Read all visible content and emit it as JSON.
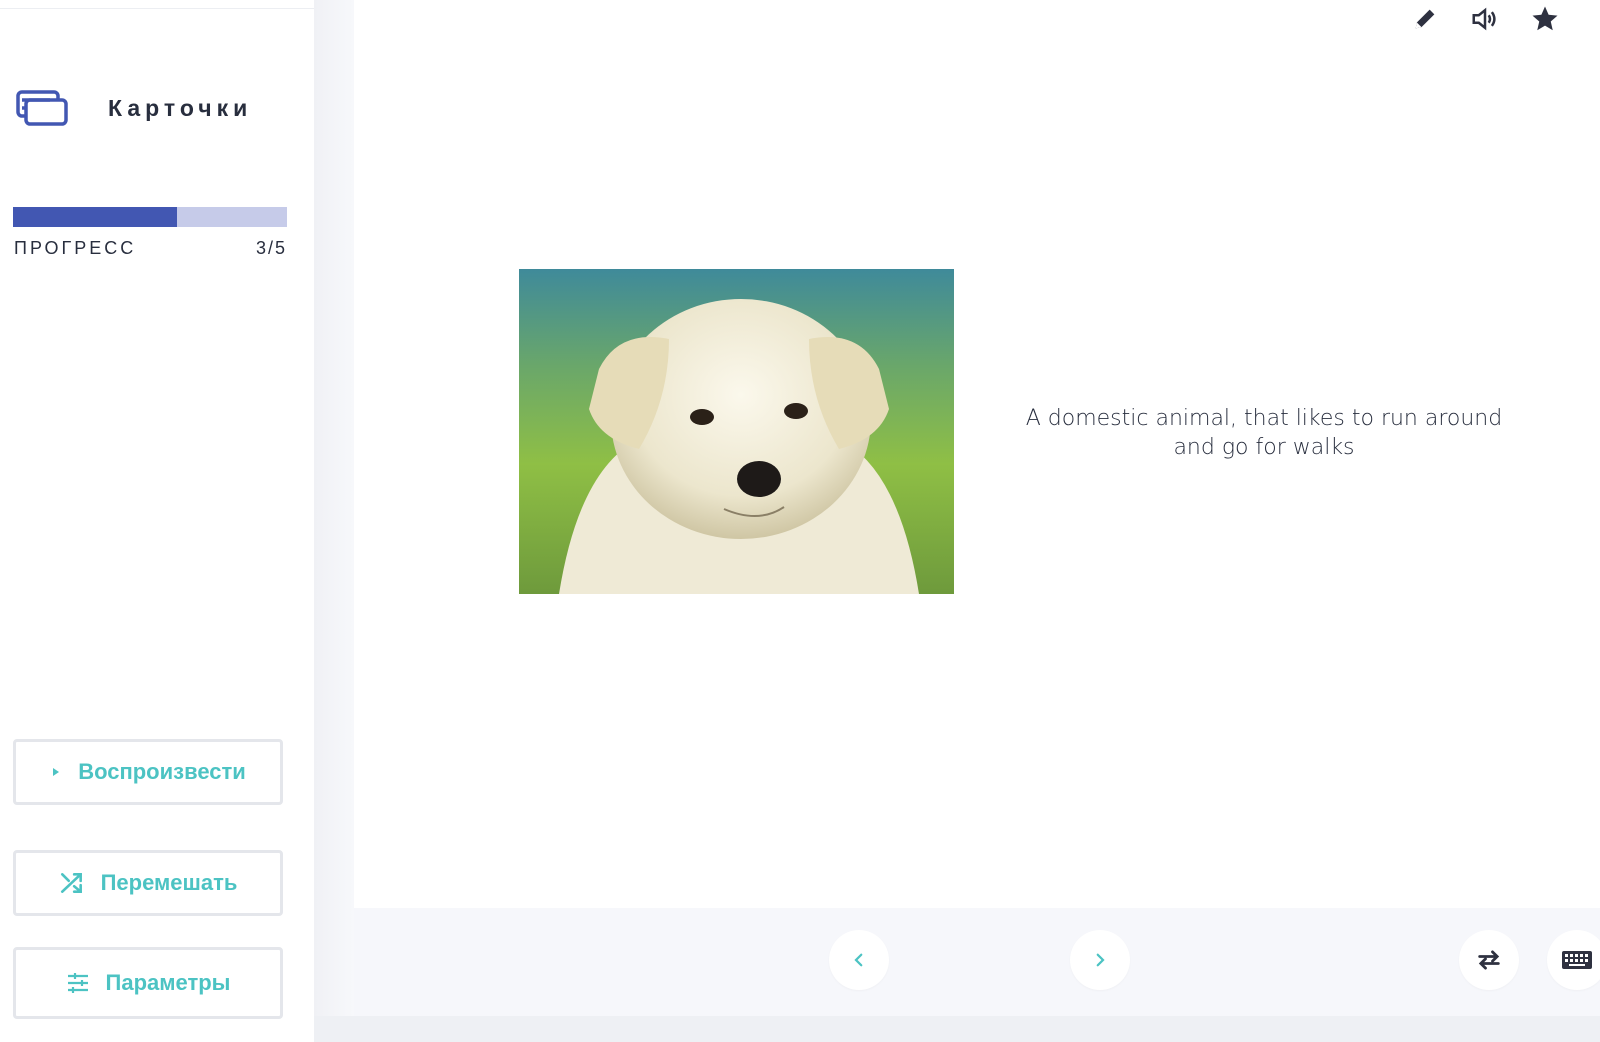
{
  "sidebar": {
    "mode_title": "Карточки",
    "mode_icon": "cards-icon",
    "progress": {
      "label": "ПРОГРЕСС",
      "count": "3/5",
      "current": 3,
      "total": 5
    },
    "buttons": {
      "play": {
        "label": "Воспроизвести",
        "icon": "play-icon"
      },
      "shuffle": {
        "label": "Перемешать",
        "icon": "shuffle-icon"
      },
      "options": {
        "label": "Параметры",
        "icon": "sliders-icon"
      }
    }
  },
  "toolbar": {
    "icons": [
      "edit-icon",
      "audio-icon",
      "star-icon"
    ]
  },
  "card": {
    "image": "puppy-photo",
    "definition": "A domestic animal, that likes to run around and go for walks"
  },
  "navigation": {
    "icons": [
      "chevron-left-icon",
      "chevron-right-icon",
      "swap-icon",
      "keyboard-icon"
    ]
  },
  "colors": {
    "accent": "#4cc3c3",
    "progress_fill": "#4257b2",
    "progress_track": "#c6cbe9",
    "text": "#282e3e",
    "bottom_bar": "#f6f7fb"
  }
}
